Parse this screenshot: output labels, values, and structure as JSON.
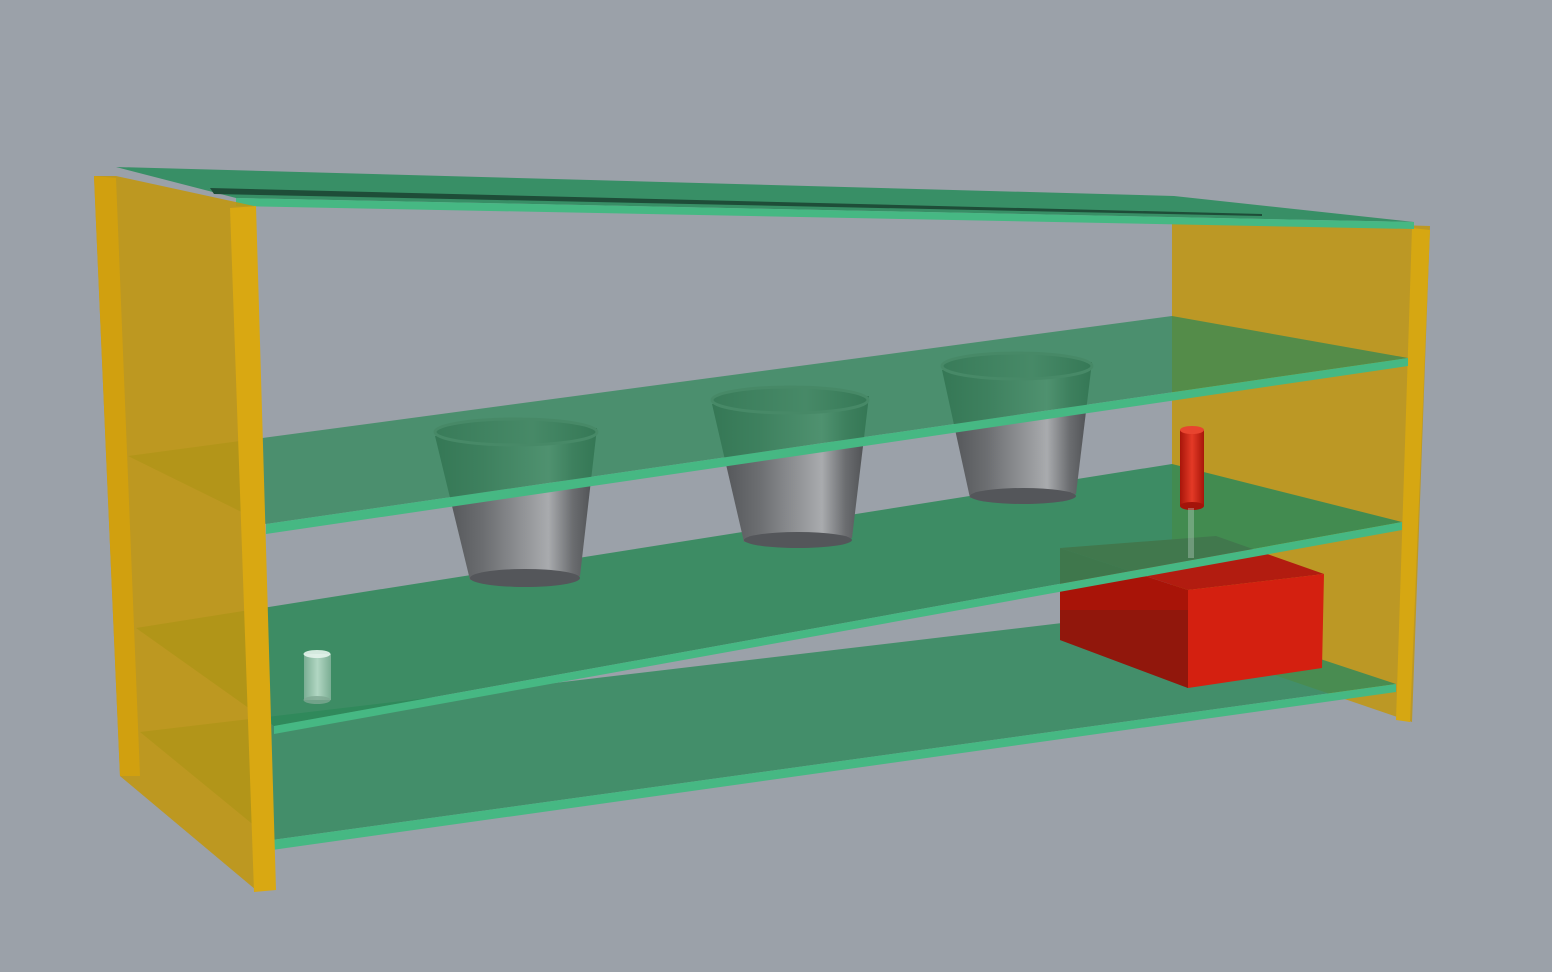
{
  "scene": {
    "background": "#9ba1a9",
    "colors": {
      "side_panel": "#d4a20f",
      "side_panel_dark": "#b88a0c",
      "shelf": "#2f8a5c",
      "shelf_edge": "#44b581",
      "bucket": "#5d5f62",
      "bucket_light": "#a7a9ac",
      "red_box": "#d42010",
      "red_cylinder": "#d8281a",
      "glass_cylinder": "#c6e3d4"
    },
    "objects": [
      {
        "name": "left-side-panel",
        "type": "panel",
        "color": "side_panel"
      },
      {
        "name": "right-side-panel",
        "type": "panel",
        "color": "side_panel"
      },
      {
        "name": "top-shelf",
        "type": "shelf",
        "color": "shelf"
      },
      {
        "name": "upper-shelf",
        "type": "shelf",
        "color": "shelf"
      },
      {
        "name": "middle-shelf",
        "type": "shelf",
        "color": "shelf"
      },
      {
        "name": "bottom-shelf",
        "type": "shelf",
        "color": "shelf"
      },
      {
        "name": "bucket",
        "type": "truncated-cone",
        "color": "bucket",
        "count": 3
      },
      {
        "name": "red-box",
        "type": "box",
        "color": "red_box"
      },
      {
        "name": "red-cylinder",
        "type": "cylinder",
        "color": "red_cylinder"
      },
      {
        "name": "small-glass-cylinder",
        "type": "cylinder",
        "color": "glass_cylinder"
      }
    ]
  }
}
